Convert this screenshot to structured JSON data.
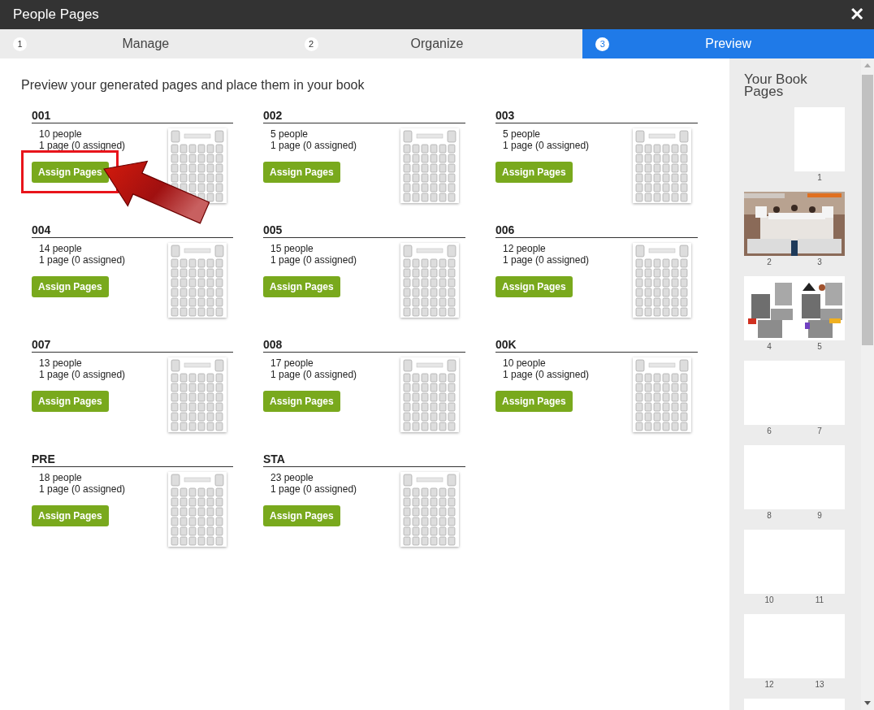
{
  "window": {
    "title": "People Pages",
    "close": "✕"
  },
  "tabs": [
    {
      "number": "1",
      "label": "Manage",
      "selected": false
    },
    {
      "number": "2",
      "label": "Organize",
      "selected": false
    },
    {
      "number": "3",
      "label": "Preview",
      "selected": true
    }
  ],
  "instruction": "Preview your generated pages and place them in your book",
  "groups": [
    {
      "name": "001",
      "people": "10 people",
      "pages": "1 page (0 assigned)",
      "button": "Assign Pages",
      "highlighted": true
    },
    {
      "name": "002",
      "people": "5 people",
      "pages": "1 page (0 assigned)",
      "button": "Assign Pages",
      "highlighted": false
    },
    {
      "name": "003",
      "people": "5 people",
      "pages": "1 page (0 assigned)",
      "button": "Assign Pages",
      "highlighted": false
    },
    {
      "name": "004",
      "people": "14 people",
      "pages": "1 page (0 assigned)",
      "button": "Assign Pages",
      "highlighted": false
    },
    {
      "name": "005",
      "people": "15 people",
      "pages": "1 page (0 assigned)",
      "button": "Assign Pages",
      "highlighted": false
    },
    {
      "name": "006",
      "people": "12 people",
      "pages": "1 page (0 assigned)",
      "button": "Assign Pages",
      "highlighted": false
    },
    {
      "name": "007",
      "people": "13 people",
      "pages": "1 page (0 assigned)",
      "button": "Assign Pages",
      "highlighted": false
    },
    {
      "name": "008",
      "people": "17 people",
      "pages": "1 page (0 assigned)",
      "button": "Assign Pages",
      "highlighted": false
    },
    {
      "name": "00K",
      "people": "10 people",
      "pages": "1 page (0 assigned)",
      "button": "Assign Pages",
      "highlighted": false
    },
    {
      "name": "PRE",
      "people": "18 people",
      "pages": "1 page (0 assigned)",
      "button": "Assign Pages",
      "highlighted": false
    },
    {
      "name": "STA",
      "people": "23 people",
      "pages": "1 page (0 assigned)",
      "button": "Assign Pages",
      "highlighted": false
    }
  ],
  "sidebar": {
    "title": "Your Book Pages",
    "spreads": [
      {
        "kind": "single",
        "pages": [
          "1"
        ]
      },
      {
        "kind": "picture",
        "pages": [
          "2",
          "3"
        ]
      },
      {
        "kind": "collage",
        "pages": [
          "4",
          "5"
        ]
      },
      {
        "kind": "blank",
        "pages": [
          "6",
          "7"
        ]
      },
      {
        "kind": "blank",
        "pages": [
          "8",
          "9"
        ]
      },
      {
        "kind": "blank",
        "pages": [
          "10",
          "11"
        ]
      },
      {
        "kind": "blank",
        "pages": [
          "12",
          "13"
        ]
      },
      {
        "kind": "blank"
      }
    ]
  }
}
